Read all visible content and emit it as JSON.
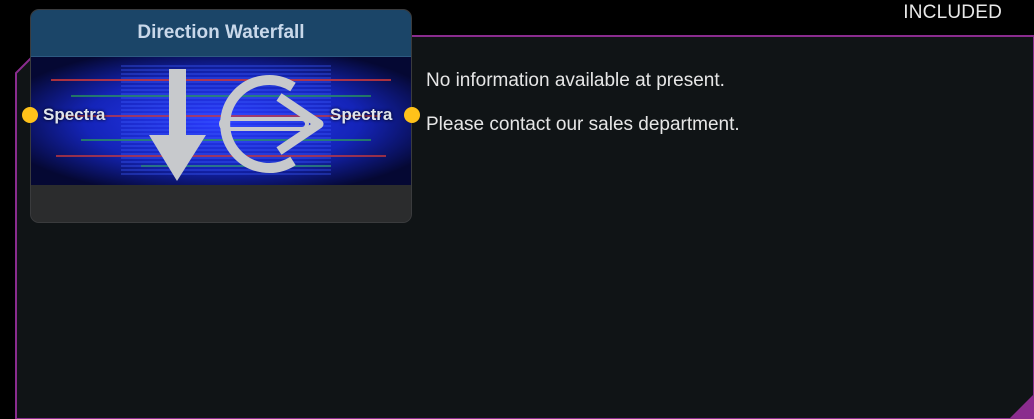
{
  "badge": "INCLUDED",
  "node": {
    "title": "Direction Waterfall",
    "input_port_label": "Spectra",
    "output_port_label": "Spectra",
    "icon": "direction-waterfall-icon"
  },
  "info": {
    "lines": [
      "No information available at present.",
      "Please contact our sales department."
    ]
  },
  "colors": {
    "frame_border": "#8a2c8e",
    "panel_bg": "#101416",
    "port": "#ffc21a",
    "header_bg": "#1b4568"
  }
}
